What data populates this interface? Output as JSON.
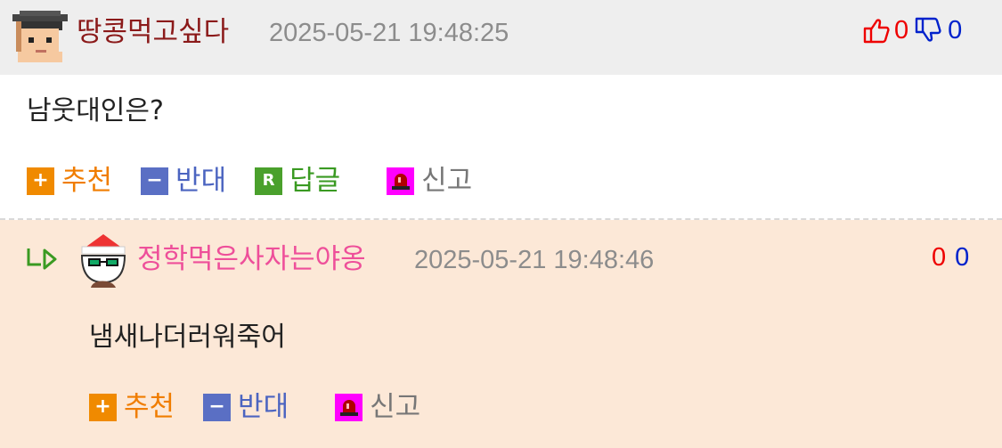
{
  "comments": [
    {
      "nickname": "땅콩먹고싶다",
      "date": "2025-05-21 19:48:25",
      "up_count": "0",
      "down_count": "0",
      "text": "남웃대인은?",
      "actions": {
        "recommend": "추천",
        "oppose": "반대",
        "reply": "답글",
        "report": "신고"
      },
      "nick_color": "#8b1a1a"
    },
    {
      "nickname": "정학먹은사자는야옹",
      "date": "2025-05-21 19:48:46",
      "up_count": "0",
      "down_count": "0",
      "text": "냄새나더러워죽어",
      "actions": {
        "recommend": "추천",
        "oppose": "반대",
        "report": "신고"
      },
      "nick_color": "#ee4f9a"
    }
  ],
  "icons": {
    "thumb_up": "thumbs-up-icon",
    "thumb_down": "thumbs-down-icon",
    "reply_arrow": "reply-arrow-icon",
    "plus": "plus-badge-icon",
    "minus": "minus-badge-icon",
    "reply_badge": "R",
    "report": "siren-icon"
  },
  "colors": {
    "header_bg": "#eeeeee",
    "reply_bg": "#fce8d7",
    "up": "#ee0000",
    "down": "#0022cc"
  }
}
